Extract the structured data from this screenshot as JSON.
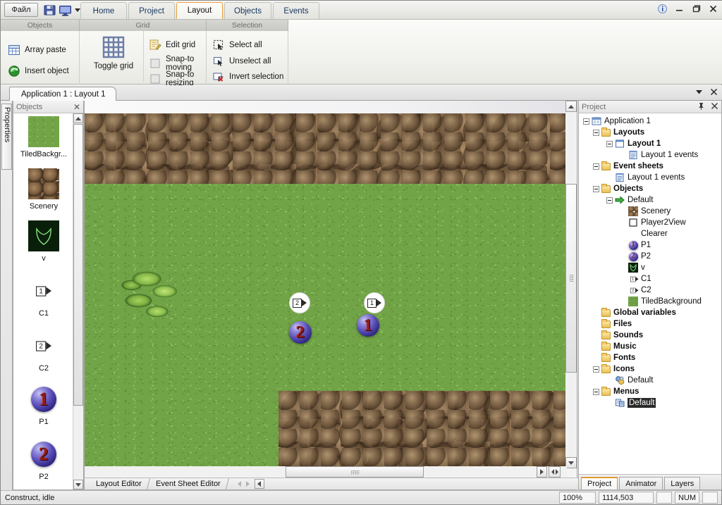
{
  "window": {
    "file_button": "Файл",
    "quick_access": [
      {
        "name": "save-icon",
        "label": "Save"
      },
      {
        "name": "preview-icon",
        "label": "Preview"
      }
    ],
    "tabs": [
      {
        "label": "Home",
        "active": false
      },
      {
        "label": "Project",
        "active": false
      },
      {
        "label": "Layout",
        "active": true
      },
      {
        "label": "Objects",
        "active": false
      },
      {
        "label": "Events",
        "active": false
      }
    ],
    "controls": [
      "info",
      "minimize",
      "restore",
      "close"
    ]
  },
  "ribbon": {
    "groups": [
      {
        "title": "Objects",
        "items": [
          {
            "label": "Array paste",
            "icon": "array-paste-icon"
          },
          {
            "label": "Insert object",
            "icon": "insert-object-icon"
          }
        ]
      },
      {
        "title": "Grid",
        "big_button": {
          "label": "Toggle grid",
          "icon": "grid-icon"
        },
        "items": [
          {
            "label": "Edit grid",
            "icon": "edit-grid-icon"
          },
          {
            "label": "Snap-to moving",
            "icon": "snap-moving-icon"
          },
          {
            "label": "Snap-to resizing",
            "icon": "snap-resizing-icon"
          }
        ]
      },
      {
        "title": "Selection",
        "items": [
          {
            "label": "Select all",
            "icon": "select-all-icon"
          },
          {
            "label": "Unselect all",
            "icon": "unselect-all-icon"
          },
          {
            "label": "Invert selection",
            "icon": "invert-selection-icon"
          }
        ]
      }
    ]
  },
  "document": {
    "tab_label": "Application 1 : Layout 1"
  },
  "left_strip": {
    "properties_label": "Properties"
  },
  "objects_panel": {
    "title": "Objects",
    "items": [
      {
        "label": "TiledBackgr...",
        "thumb": "grass-thumb"
      },
      {
        "label": "Scenery",
        "thumb": "rock-thumb"
      },
      {
        "label": "v",
        "thumb": "v-thumb"
      },
      {
        "label": "C1",
        "thumb": "camera1-thumb"
      },
      {
        "label": "C2",
        "thumb": "camera2-thumb"
      },
      {
        "label": "P1",
        "thumb": "player1-thumb"
      },
      {
        "label": "P2",
        "thumb": "player2-thumb"
      }
    ]
  },
  "canvas": {
    "sprites": [
      {
        "name": "camera-marker-c2",
        "label": "2",
        "type": "camera"
      },
      {
        "name": "camera-marker-c1",
        "label": "1",
        "type": "camera"
      },
      {
        "name": "player-2",
        "label": "2",
        "type": "ball"
      },
      {
        "name": "player-1",
        "label": "1",
        "type": "ball"
      }
    ],
    "editor_tabs": [
      {
        "label": "Layout Editor",
        "active": true
      },
      {
        "label": "Event Sheet Editor",
        "active": false
      }
    ]
  },
  "project_panel": {
    "title": "Project",
    "tree": [
      {
        "label": "Application 1",
        "depth": 0,
        "expander": true,
        "icon": "application-icon",
        "bold": false,
        "selected": false
      },
      {
        "label": "Layouts",
        "depth": 1,
        "expander": true,
        "icon": "folder-icon",
        "bold": true,
        "selected": false
      },
      {
        "label": "Layout 1",
        "depth": 2,
        "expander": true,
        "icon": "layout-icon",
        "bold": true,
        "selected": false
      },
      {
        "label": "Layout 1 events",
        "depth": 3,
        "expander": false,
        "icon": "eventsheet-icon",
        "bold": false,
        "selected": false
      },
      {
        "label": "Event sheets",
        "depth": 1,
        "expander": true,
        "icon": "folder-icon",
        "bold": true,
        "selected": false
      },
      {
        "label": "Layout 1 events",
        "depth": 2,
        "expander": false,
        "icon": "eventsheet-icon",
        "bold": false,
        "selected": false
      },
      {
        "label": "Objects",
        "depth": 1,
        "expander": true,
        "icon": "folder-icon",
        "bold": true,
        "selected": false
      },
      {
        "label": "Default",
        "depth": 2,
        "expander": true,
        "icon": "green-arrow-icon",
        "bold": false,
        "selected": false
      },
      {
        "label": "Scenery",
        "depth": 3,
        "expander": false,
        "icon": "rock-icon",
        "bold": false,
        "selected": false
      },
      {
        "label": "Player2View",
        "depth": 3,
        "expander": false,
        "icon": "white-box-icon",
        "bold": false,
        "selected": false
      },
      {
        "label": "Clearer",
        "depth": 3,
        "expander": false,
        "icon": "blank-icon",
        "bold": false,
        "selected": false
      },
      {
        "label": "P1",
        "depth": 3,
        "expander": false,
        "icon": "player1-icon",
        "bold": false,
        "selected": false
      },
      {
        "label": "P2",
        "depth": 3,
        "expander": false,
        "icon": "player2-icon",
        "bold": false,
        "selected": false
      },
      {
        "label": "v",
        "depth": 3,
        "expander": false,
        "icon": "v-icon",
        "bold": false,
        "selected": false
      },
      {
        "label": "C1",
        "depth": 3,
        "expander": false,
        "icon": "camera1-icon",
        "bold": false,
        "selected": false
      },
      {
        "label": "C2",
        "depth": 3,
        "expander": false,
        "icon": "camera2-icon",
        "bold": false,
        "selected": false
      },
      {
        "label": "TiledBackground",
        "depth": 3,
        "expander": false,
        "icon": "grass-icon",
        "bold": false,
        "selected": false
      },
      {
        "label": "Global variables",
        "depth": 1,
        "expander": false,
        "icon": "folder-icon",
        "bold": true,
        "selected": false
      },
      {
        "label": "Files",
        "depth": 1,
        "expander": false,
        "icon": "folder-icon",
        "bold": true,
        "selected": false
      },
      {
        "label": "Sounds",
        "depth": 1,
        "expander": false,
        "icon": "folder-icon",
        "bold": true,
        "selected": false
      },
      {
        "label": "Music",
        "depth": 1,
        "expander": false,
        "icon": "folder-icon",
        "bold": true,
        "selected": false
      },
      {
        "label": "Fonts",
        "depth": 1,
        "expander": false,
        "icon": "folder-icon",
        "bold": true,
        "selected": false
      },
      {
        "label": "Icons",
        "depth": 1,
        "expander": true,
        "icon": "folder-icon",
        "bold": true,
        "selected": false
      },
      {
        "label": "Default",
        "depth": 2,
        "expander": false,
        "icon": "icons-default-icon",
        "bold": false,
        "selected": false
      },
      {
        "label": "Menus",
        "depth": 1,
        "expander": true,
        "icon": "folder-icon",
        "bold": true,
        "selected": false
      },
      {
        "label": "Default",
        "depth": 2,
        "expander": false,
        "icon": "menus-default-icon",
        "bold": false,
        "selected": true
      }
    ],
    "tabs": [
      {
        "label": "Project",
        "active": true
      },
      {
        "label": "Animator",
        "active": false
      },
      {
        "label": "Layers",
        "active": false
      }
    ]
  },
  "status_bar": {
    "message": "Construct, idle",
    "zoom": "100%",
    "coordinates": "1114,503",
    "blank_cell": "",
    "num_lock": "NUM",
    "trailing_cell": ""
  },
  "colors": {
    "accent": "#e8a33d",
    "tab_active_border": "#e09a33",
    "grass": "#71a347",
    "rock": "#6a5139",
    "ball": "#5a4fb8"
  }
}
